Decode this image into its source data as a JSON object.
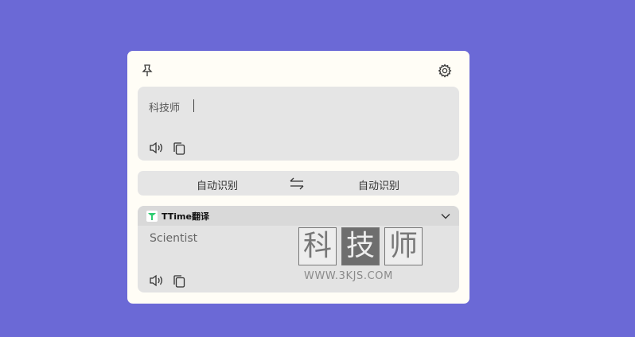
{
  "colors": {
    "background": "#6b69d6",
    "window": "#fffdf6",
    "panel": "#e5e5e5",
    "accent_logo": "#2ecc71"
  },
  "toolbar": {
    "pin_icon": "pin-icon",
    "settings_icon": "gear-icon"
  },
  "source": {
    "text": "科技师",
    "speaker_icon": "speaker-icon",
    "copy_icon": "copy-icon"
  },
  "languages": {
    "from": "自动识别",
    "to": "自动识别",
    "swap_icon": "swap-arrows-icon"
  },
  "result": {
    "service_name": "TTime翻译",
    "text": "Scientist",
    "collapse_icon": "chevron-down-icon"
  },
  "watermark": {
    "chars": [
      "科",
      "技",
      "师"
    ],
    "url": "WWW.3KJS.COM"
  }
}
